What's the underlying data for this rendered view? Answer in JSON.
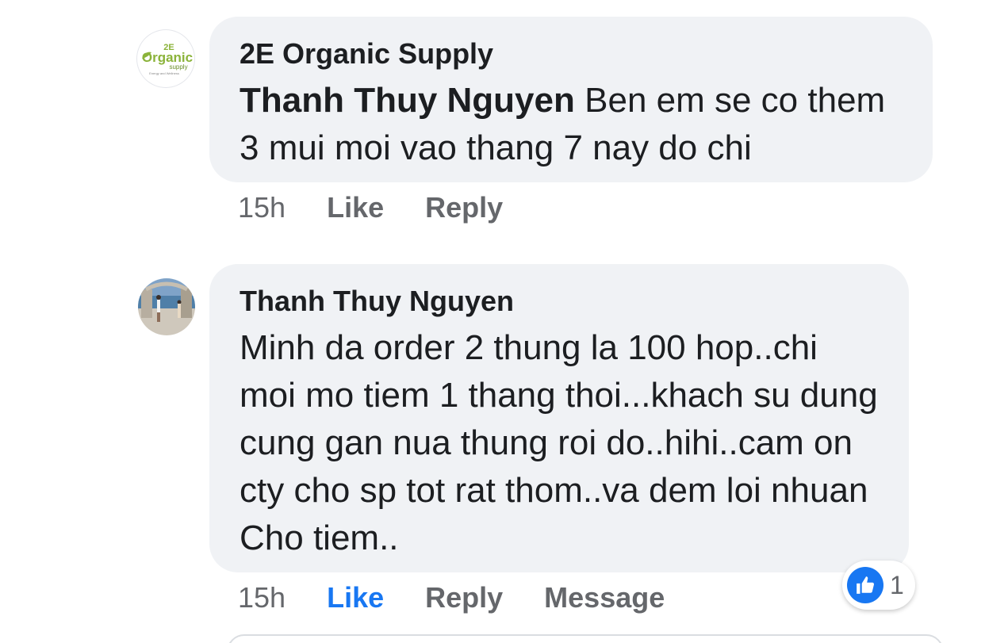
{
  "comments": [
    {
      "author": "2E Organic Supply",
      "avatar": {
        "logo_top": "2E",
        "logo_main": "Organic",
        "logo_sub": "supply",
        "logo_tagline": "Energy and Wellness",
        "logo_color": "#8bb33a"
      },
      "mention": "Thanh Thuy Nguyen",
      "text": "Ben em se co them 3 mui moi vao thang 7 nay do chi",
      "time": "15h",
      "actions": [
        "Like",
        "Reply"
      ]
    },
    {
      "author": "Thanh Thuy Nguyen",
      "avatar": {
        "icon": "photo-avatar"
      },
      "text": "Minh da order 2 thung la 100 hop..chi moi mo tiem 1 thang thoi...khach su dung cung gan nua thung roi do..hihi..cam on cty cho sp tot rat thom..va dem loi nhuan Cho tiem..",
      "time": "15h",
      "actions": [
        "Like",
        "Reply",
        "Message"
      ],
      "liked": true,
      "reaction": {
        "icon": "thumbs-up-icon",
        "count": "1"
      }
    }
  ],
  "colors": {
    "bubble": "#f0f2f5",
    "text": "#1c1e21",
    "secondary": "#65676b",
    "accent": "#1877f2"
  }
}
